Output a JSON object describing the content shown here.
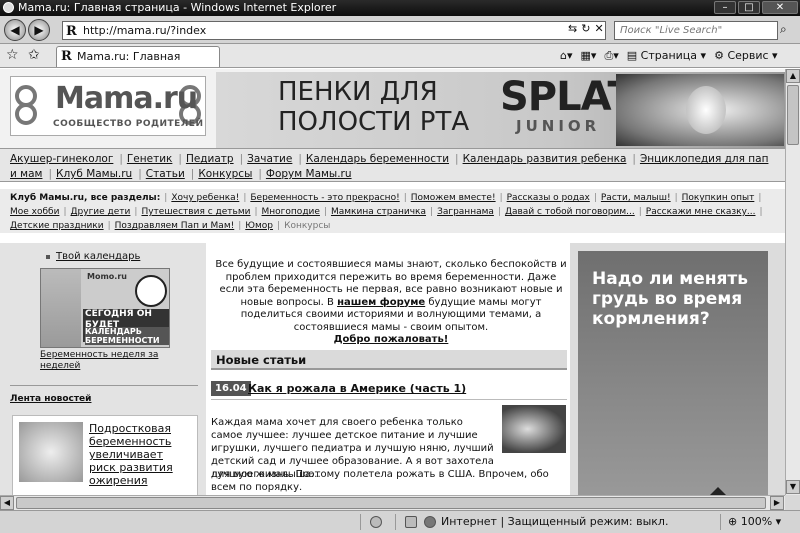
{
  "window": {
    "title": "Mama.ru: Главная страница - Windows Internet Explorer"
  },
  "address_bar": {
    "url": "http://mama.ru/?index",
    "search_placeholder": "Поиск \"Live Search\""
  },
  "tab": {
    "label": "Mama.ru: Главная страница"
  },
  "command_bar": {
    "page_label": "Страница",
    "service_label": "Сервис"
  },
  "site": {
    "logo_title": "Mama.ru",
    "logo_subtitle": "СООБЩЕСТВО РОДИТЕЛЕЙ",
    "banner_line1": "ПЕНКИ ДЛЯ",
    "banner_line2": "ПОЛОСТИ РТА",
    "banner_brand": "SPLAT",
    "banner_brand_sub": "JUNIOR"
  },
  "topnav": [
    "Акушер-гинеколог",
    "Генетик",
    "Педиатр",
    "Зачатие",
    "Календарь беременности",
    "Календарь развития ребенка",
    "Энциклопедия для пап и мам",
    "Клуб Мамы.ru",
    "Статьи",
    "Конкурсы",
    "Форум Мамы.ru"
  ],
  "sections": {
    "label": "Клуб Мамы.ru, все разделы:",
    "items": [
      "Хочу ребенка!",
      "Беременность - это прекрасно!",
      "Поможем вместе!",
      "Рассказы о родах",
      "Расти, малыш!",
      "Покупкин опыт",
      "Мое хобби",
      "Другие дети",
      "Путешествия с детьми",
      "Многоподие",
      "Мамкина страничка",
      "Заграннама",
      "Давай с тобой поговорим...",
      "Расскажи мне сказку...",
      "Детские праздники",
      "Поздравляем Пап и Мам!",
      "Юмор"
    ],
    "last_item": "Конкурсы"
  },
  "left": {
    "calendar_link": "Твой календарь",
    "banner_brand": "Momo.ru",
    "banner_text1": "СЕГОДНЯ ОН БУДЕТ ПИНАТЬСЯ!",
    "banner_text2": "КАЛЕНДАРЬ БЕРЕМЕННОСТИ",
    "week_link": "Беременность неделя за неделей",
    "news_header": "Лента новостей",
    "news_item": "Подростковая беременность увеличивает риск развития ожирения"
  },
  "intro": {
    "text1": "Все будущие и состоявшиеся мамы знают, сколько беспокойств и проблем приходится пережить во время беременности. Даже если эта беременность не первая, все равно возникают новые и новые вопросы. В",
    "forum_link": "нашем форуме",
    "text2": "будущие мамы могут поделиться своими историями и волнующими темами, а состоявшиеся мамы - своим опытом.",
    "welcome_link": "Добро пожаловать!"
  },
  "articles": {
    "header": "Новые статьи",
    "date": "16.04",
    "title": "Как я рожала в Америке (часть 1)",
    "text1": "Каждая мама хочет для своего ребенка только самое лучшее: лучшее детское питание и лучшие игрушки, лучшего педиатра и лучшую няню, лучший детский сад и лучшее образование. А я вот захотела для моего малыша...",
    "text2": "лучшую жизнь. Поэтому полетела рожать в США. Впрочем, обо всем по порядку."
  },
  "right_ad": {
    "text": "Надо ли менять грудь во время кормления?"
  },
  "status": {
    "zone": "Интернет | Защищенный режим: выкл.",
    "zoom": "100%"
  }
}
